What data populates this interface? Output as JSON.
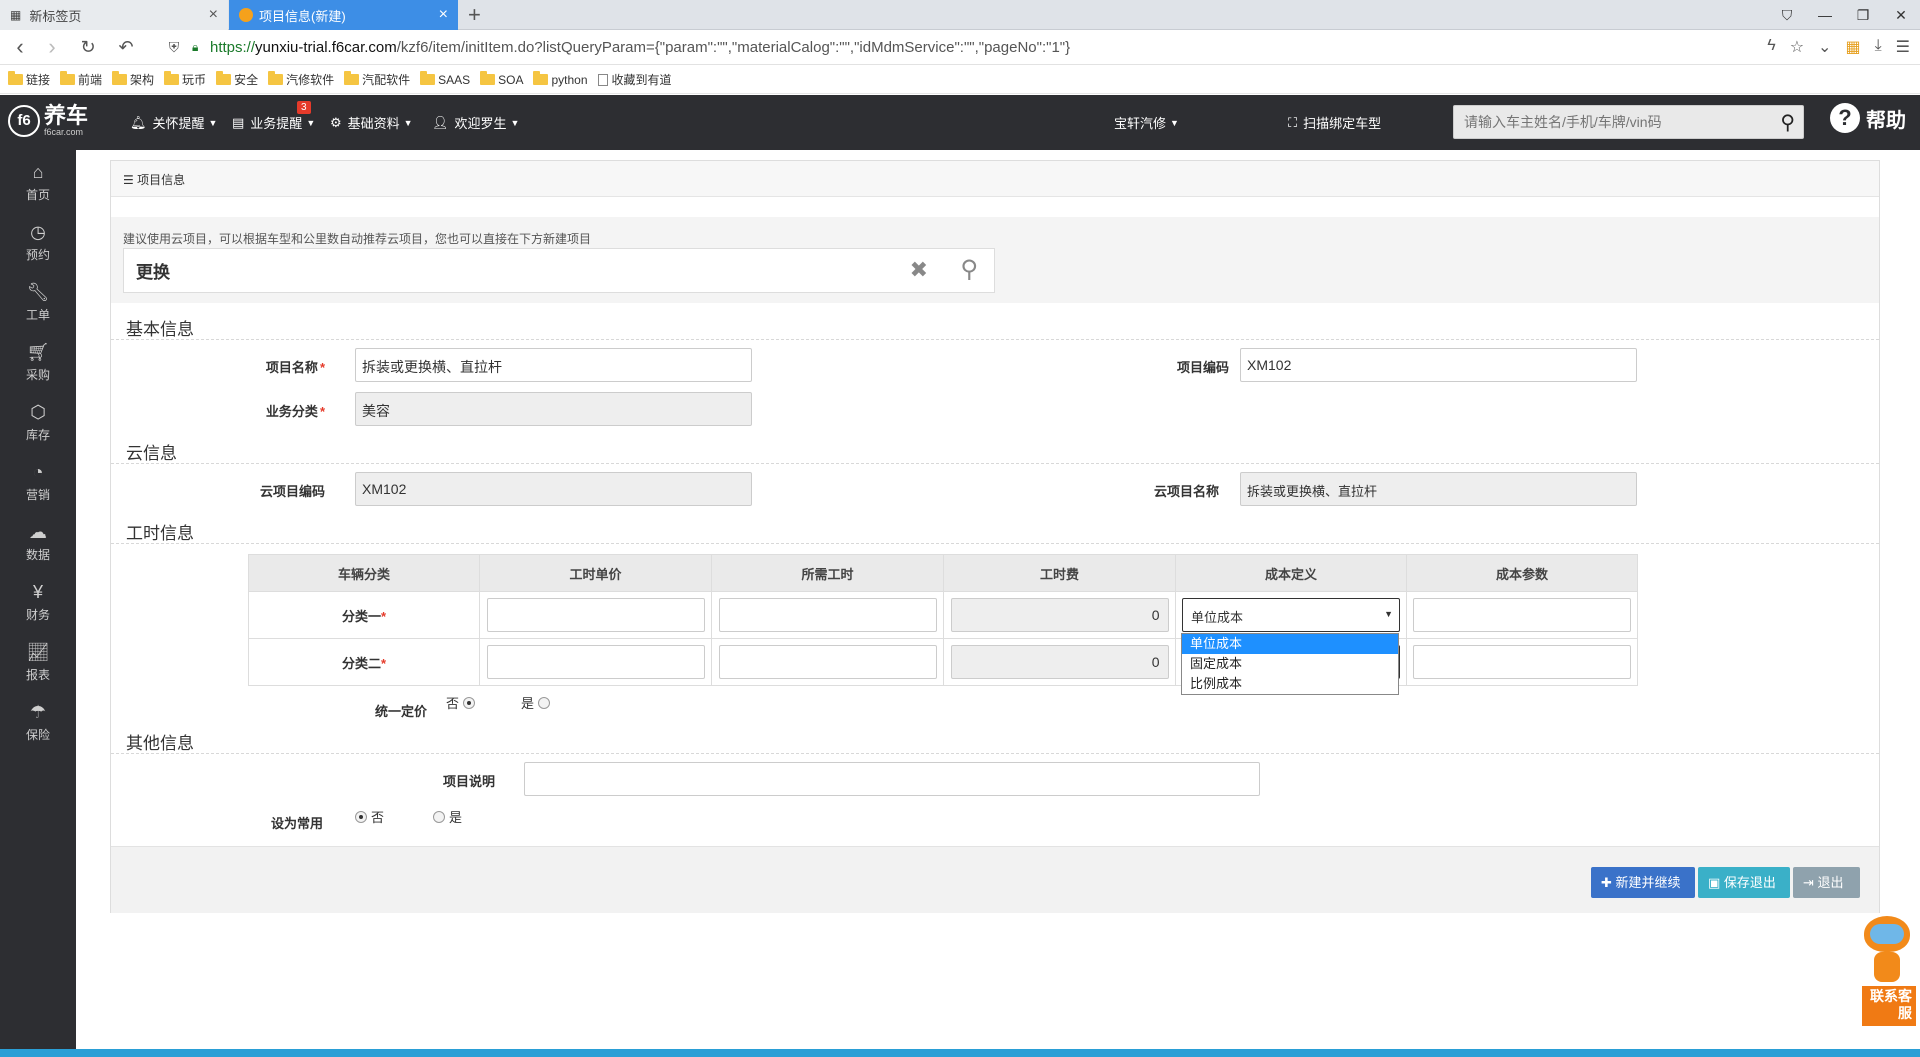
{
  "browser": {
    "tabs": [
      {
        "title": "新标签页"
      },
      {
        "title": "项目信息(新建)"
      }
    ],
    "url_scheme": "https://",
    "url_host": "yunxiu-trial.f6car.com",
    "url_path": "/kzf6/item/initItem.do?listQueryParam={\"param\":\"\",\"materialCalog\":\"\",\"idMdmService\":\"\",\"pageNo\":\"1\"}",
    "bookmarks": [
      "链接",
      "前端",
      "架构",
      "玩币",
      "安全",
      "汽修软件",
      "汽配软件",
      "SAAS",
      "SOA",
      "python",
      "收藏到有道"
    ]
  },
  "app": {
    "logo_text": "养车",
    "logo_sub": "f6car.com",
    "logo_mark": "f6",
    "nav": {
      "care": "关怀提醒",
      "business": "业务提醒",
      "business_badge": "3",
      "basic": "基础资料",
      "welcome": "欢迎罗生",
      "store": "宝轩汽修",
      "scan": "扫描绑定车型"
    },
    "search_placeholder": "请输入车主姓名/手机/车牌/vin码",
    "help": "帮助",
    "sidebar": [
      "首页",
      "预约",
      "工单",
      "采购",
      "库存",
      "营销",
      "数据",
      "财务",
      "报表",
      "保险"
    ]
  },
  "page": {
    "panel_title": "项目信息",
    "hint": "建议使用云项目，可以根据车型和公里数自动推荐云项目，您也可以直接在下方新建项目",
    "search_value": "更换",
    "sections": {
      "basic": "基本信息",
      "cloud": "云信息",
      "labor": "工时信息",
      "other": "其他信息"
    },
    "basic": {
      "name_label": "项目名称",
      "name_value": "拆装或更换横、直拉杆",
      "code_label": "项目编码",
      "code_value": "XM102",
      "category_label": "业务分类",
      "category_value": "美容"
    },
    "cloud": {
      "code_label": "云项目编码",
      "code_value": "XM102",
      "name_label": "云项目名称",
      "name_value": "拆装或更换横、直拉杆"
    },
    "labor": {
      "headers": [
        "车辆分类",
        "工时单价",
        "所需工时",
        "工时费",
        "成本定义",
        "成本参数"
      ],
      "rows": [
        {
          "label": "分类一",
          "fee": "0",
          "cost_def": "单位成本"
        },
        {
          "label": "分类二",
          "fee": "0",
          "cost_def": ""
        }
      ],
      "dropdown_options": [
        "单位成本",
        "固定成本",
        "比例成本"
      ],
      "unified_label": "统一定价",
      "no": "否",
      "yes": "是"
    },
    "other": {
      "desc_label": "项目说明",
      "desc_value": "",
      "common_label": "设为常用",
      "no": "否",
      "yes": "是"
    },
    "buttons": {
      "new_continue": "新建并继续",
      "save_exit": "保存退出",
      "exit": "退出"
    },
    "service": "联系客服"
  }
}
